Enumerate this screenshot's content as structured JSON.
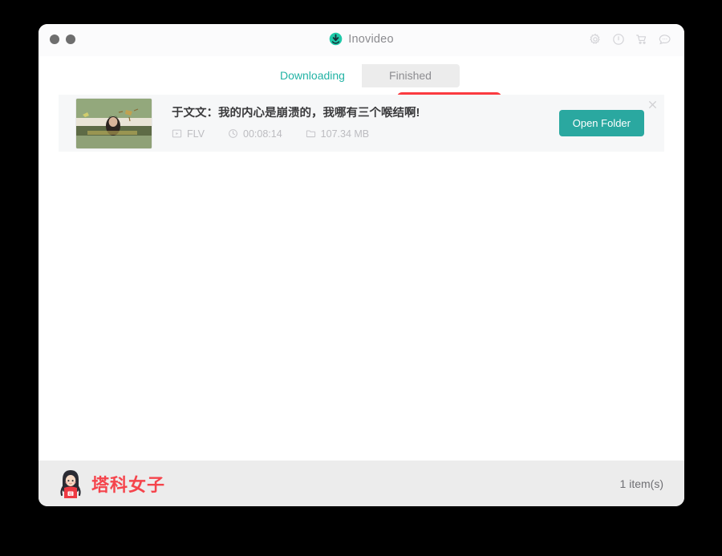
{
  "window": {
    "title": "Inovideo",
    "app_icon": "download-circle-icon",
    "traffic_lights": [
      "minimize-dot",
      "maximize-dot"
    ],
    "actions": [
      {
        "name": "gear-icon",
        "label": "Settings"
      },
      {
        "name": "info-icon",
        "label": "Information"
      },
      {
        "name": "cart-icon",
        "label": "Store"
      },
      {
        "name": "chat-icon",
        "label": "Feedback"
      }
    ]
  },
  "tabs": {
    "items": [
      {
        "label": "Downloading",
        "active": false
      },
      {
        "label": "Finished",
        "active": true
      }
    ],
    "highlight_color": "#fb3b40",
    "active_tab": "Finished"
  },
  "list": {
    "rows": [
      {
        "title": "于文文：我的内心是崩溃的，我哪有三个喉结啊!",
        "format": "FLV",
        "duration": "00:08:14",
        "size": "107.34 MB",
        "action_label": "Open Folder",
        "format_icon": "video-file-icon",
        "duration_icon": "clock-icon",
        "size_icon": "folder-icon",
        "close_icon": "close-icon",
        "thumbnail_alt": "video-thumbnail"
      }
    ]
  },
  "footer": {
    "watermark_text": "塔科女子",
    "watermark_color": "#f5444c",
    "item_count": "1 item(s)"
  },
  "colors": {
    "accent_teal": "#2aa8a0",
    "tab_link_teal": "#23b3a5",
    "annotation_red": "#fb3b40",
    "footer_bg": "#ececec",
    "row_bg": "#f6f7f8"
  }
}
